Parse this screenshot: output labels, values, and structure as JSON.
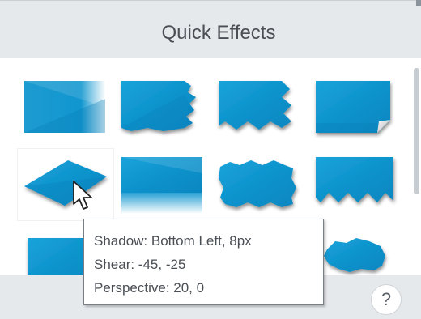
{
  "panel": {
    "title": "Quick Effects",
    "help_label": "?"
  },
  "effects": [
    {
      "effect": "edge-fade"
    },
    {
      "effect": "torn-edge-right"
    },
    {
      "effect": "zigzag-edge-bottom-right"
    },
    {
      "effect": "page-curl"
    },
    {
      "effect": "shear-perspective-shadow"
    },
    {
      "effect": "reflection"
    },
    {
      "effect": "torn-edges-all-sides"
    },
    {
      "effect": "zigzag-edge-bottom"
    },
    {
      "effect": "shadow-small"
    },
    {
      "effect": "irregular-blob"
    }
  ],
  "tooltip": {
    "line1": "Shadow: Bottom Left, 8px",
    "line2": "Shear: -45, -25",
    "line3": "Perspective: 20, 0"
  },
  "colors": {
    "header_bg": "#e6e9ec",
    "tile_blue": "#1196cf",
    "tile_blue_dark": "#0a7fb8",
    "title_text": "#4a4f55"
  },
  "icons": {
    "cursor": "arrow-pointer-icon",
    "help": "question-mark-icon"
  }
}
